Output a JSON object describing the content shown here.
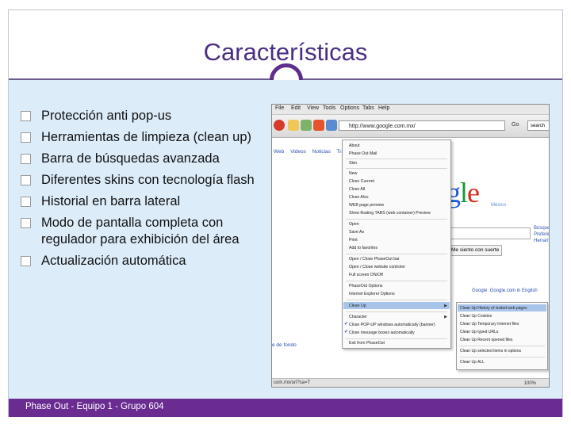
{
  "slide": {
    "title": "Características",
    "bullets": [
      "Protección anti pop-us",
      "Herramientas de limpieza (clean up)",
      "Barra de búsquedas avanzada",
      "Diferentes skins con tecnología flash",
      "Historial en barra lateral",
      "Modo de pantalla completa con regulador para exhibición del área",
      "Actualización automática"
    ],
    "footer": "Phase Out - Equipo 1 - Grupo 604"
  },
  "browser": {
    "menubar": [
      "File",
      "Edit",
      "View",
      "Tools",
      "Options",
      "Tabs",
      "Help"
    ],
    "url": "http://www.google.com.mx/",
    "go": "Go",
    "search_placeholder": "search",
    "nav_links": [
      "Web",
      "Videos",
      "Noticias",
      "Traducto"
    ],
    "google_letters": [
      "g",
      "l",
      "e"
    ],
    "google_suffix": "México",
    "right_links": [
      "Búsqueda",
      "Preferenc",
      "Herramie"
    ],
    "lucky_button": "Me siento con suerte",
    "google_links": "Google.com in English",
    "google_links_prefix": "Google",
    "fondo_link": "e de fondo",
    "status_text": "com.mx/url?sa=T",
    "zoom": "100%",
    "colors": {
      "google_blue": "#1a5bd6",
      "google_red": "#d62d20",
      "google_yellow": "#f4b400",
      "google_green": "#159a36",
      "highlight": "#a8c4ea"
    }
  },
  "context_menu": {
    "items": [
      "About",
      "Phase Out Mail",
      "Skin",
      "New",
      "Close Current",
      "Close All",
      "Close Also",
      "WEB page preview",
      "Show floating TABS (web container) Preview",
      "Open",
      "Save As",
      "Print",
      "Add to favorites",
      "Open / Close PhaseOut bar",
      "Open / Close website controler",
      "Full screen ON/Off",
      "PhaseOut Options",
      "Internet Explorer Options",
      "Clean Up",
      "Character",
      "Close POP-UP windows automatically (banner)",
      "Close message boxes automatically",
      "Exit from PhaseOut"
    ],
    "submenu": [
      "Clean Up History of visited web pages",
      "Clean Up Cookies",
      "Clean Up Temporary Internet files",
      "Clean Up typed URLs",
      "Clean Up Recent opened files",
      "Clean Up selected items in options",
      "Clean Up ALL"
    ]
  }
}
